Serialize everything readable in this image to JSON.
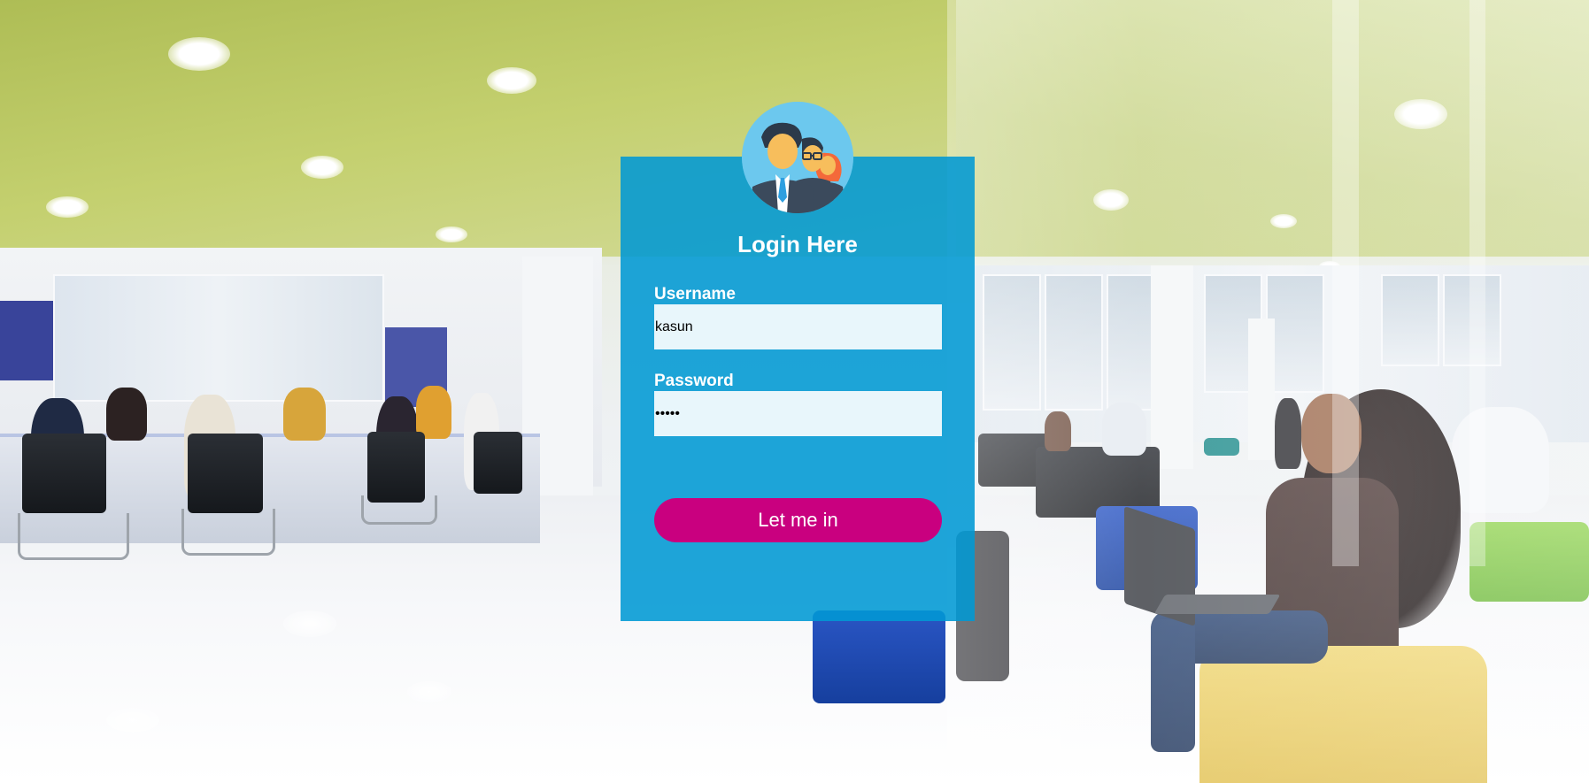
{
  "login": {
    "title": "Login Here",
    "username_label": "Username",
    "username_value": "kasun",
    "password_label": "Password",
    "password_value": "kasun",
    "submit_label": "Let me in"
  },
  "avatar": {
    "icon": "users-group-icon"
  },
  "colors": {
    "card_background": "#0099d4",
    "button_background": "#c9007f",
    "text": "#ffffff"
  }
}
